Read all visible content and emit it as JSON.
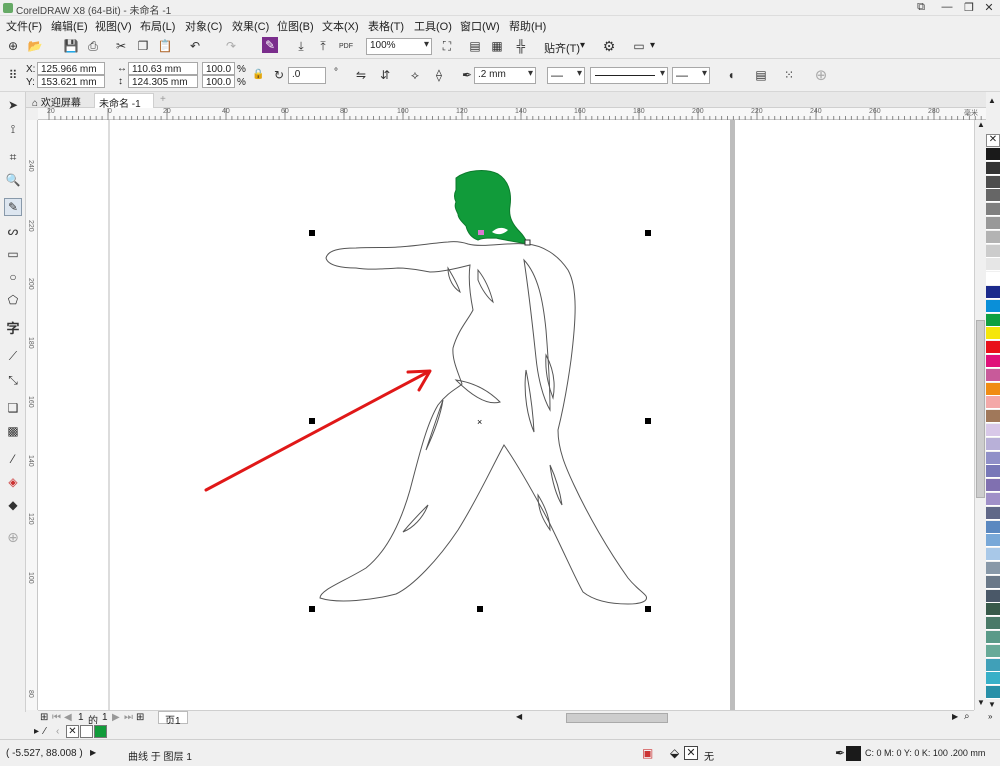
{
  "app": {
    "title": "CorelDRAW X8 (64-Bit) - 未命名 -1"
  },
  "menu": [
    "文件(F)",
    "编辑(E)",
    "视图(V)",
    "布局(L)",
    "对象(C)",
    "效果(C)",
    "位图(B)",
    "文本(X)",
    "表格(T)",
    "工具(O)",
    "窗口(W)",
    "帮助(H)"
  ],
  "standard_toolbar": {
    "zoom_value": "100%",
    "snap_label": "贴齐(T)",
    "pdf_label": "PDF"
  },
  "property_bar": {
    "x_label": "X:",
    "x_value": "125.966 mm",
    "y_label": "Y:",
    "y_value": "153.621 mm",
    "width_value": "110.63 mm",
    "height_value": "124.305 mm",
    "scale_x": "100.0",
    "scale_y": "100.0",
    "percent": "%",
    "rotation": ".0",
    "degree": "°",
    "outline_width": ".2 mm"
  },
  "doc_tabs": {
    "welcome": "欢迎屏幕",
    "document": "未命名 -1"
  },
  "hruler": {
    "ticks": [
      "20",
      "0",
      "20",
      "40",
      "60",
      "80",
      "100",
      "120",
      "140",
      "160",
      "180",
      "200",
      "220",
      "240",
      "260",
      "280"
    ],
    "unit": "毫米"
  },
  "vruler": {
    "ticks": [
      "240",
      "220",
      "200",
      "180",
      "160",
      "140",
      "120",
      "100",
      "80"
    ]
  },
  "page_nav": {
    "current": "1",
    "of": "的",
    "total": "1",
    "page_tab": "页1"
  },
  "status": {
    "coords": "( -5.527, 88.008 )",
    "object_info": "曲线 于 图层 1",
    "fill_none": "无",
    "outline_info": "C: 0 M: 0 Y: 0 K: 100  .200 mm"
  },
  "colors": {
    "figure_fill": "#119b3a",
    "arrow": "#e01818",
    "palette": [
      "#1a1a1a",
      "#333333",
      "#4d4d4d",
      "#666666",
      "#808080",
      "#999999",
      "#b3b3b3",
      "#cccccc",
      "#e6e6e6",
      "#ffffff",
      "#1b2a8c",
      "#0a8fd8",
      "#0fa040",
      "#f5e60a",
      "#e8101a",
      "#e0107a",
      "#c85a9a",
      "#f08c14",
      "#f4a8a8",
      "#a0785a",
      "#d8c8e8",
      "#b8b0d8",
      "#9090c8",
      "#7878b8",
      "#8070b0",
      "#a090c8",
      "#606888",
      "#5a88c0",
      "#78a8d8",
      "#a8c8e8",
      "#8898a8",
      "#6a7888",
      "#4a5868",
      "#385a4a",
      "#4a7a68",
      "#5a9a88",
      "#68aa98",
      "#40a0b8",
      "#38b0c8",
      "#2890a8"
    ]
  }
}
